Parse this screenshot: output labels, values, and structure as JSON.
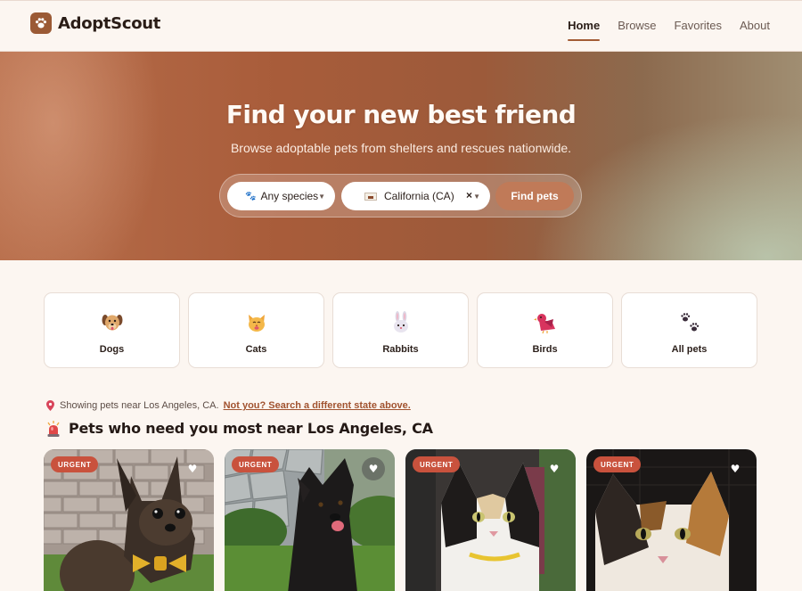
{
  "header": {
    "brand": "AdoptScout",
    "nav": [
      "Home",
      "Browse",
      "Favorites",
      "About"
    ]
  },
  "hero": {
    "title": "Find your new best friend",
    "subtitle": "Browse adoptable pets from shelters and rescues nationwide.",
    "species_value": "Any species",
    "state_value": "California (CA)",
    "clear_glyph": "×",
    "submit_label": "Find pets"
  },
  "categories": [
    "Dogs",
    "Cats",
    "Rabbits",
    "Birds",
    "All pets"
  ],
  "location": {
    "text": "Showing pets near Los Angeles, CA.",
    "link": "Not you? Search a different state above."
  },
  "section": {
    "title": "Pets who need you most near Los Angeles, CA"
  },
  "pets": [
    {
      "badge": "URGENT",
      "favorite_icon": "heart-icon"
    },
    {
      "badge": "URGENT",
      "favorite_icon": "heart-icon"
    },
    {
      "badge": "URGENT",
      "favorite_icon": "heart-icon"
    },
    {
      "badge": "URGENT",
      "favorite_icon": "heart-icon"
    }
  ],
  "colors": {
    "accent": "#a35c35",
    "button": "#c07a58",
    "urgent_badge": "#c9523d",
    "page_background": "#fcf6f1"
  }
}
